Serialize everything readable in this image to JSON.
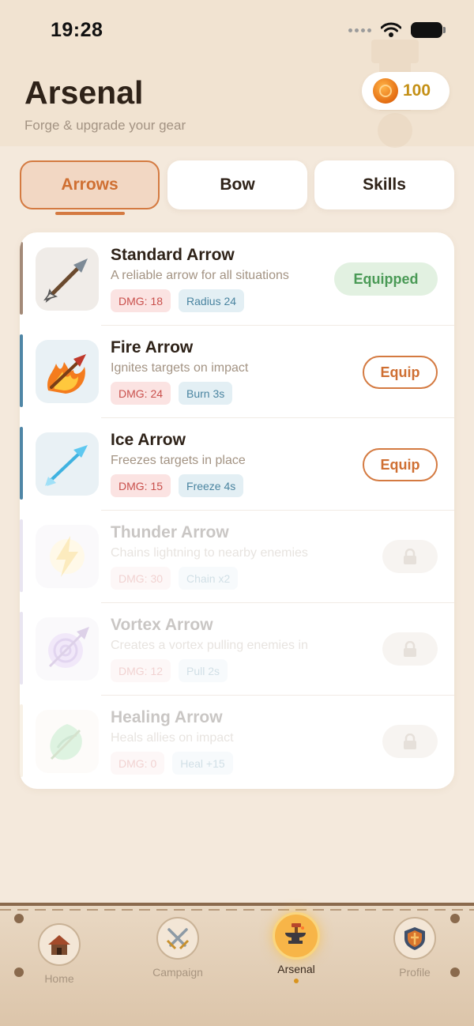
{
  "status_bar": {
    "time": "19:28"
  },
  "header": {
    "title": "Arsenal",
    "subtitle": "Forge & upgrade your gear",
    "coins": "100"
  },
  "tabs": [
    {
      "label": "Arrows",
      "active": true
    },
    {
      "label": "Bow",
      "active": false
    },
    {
      "label": "Skills",
      "active": false
    }
  ],
  "arrows": [
    {
      "name": "Standard Arrow",
      "description": "A reliable arrow for all situations",
      "damage": "DMG: 18",
      "effect": "Radius 24",
      "action": "Equipped",
      "accent": "#a38a78"
    },
    {
      "name": "Fire Arrow",
      "description": "Ignites targets on impact",
      "damage": "DMG: 24",
      "effect": "Burn 3s",
      "action": "Equip",
      "accent": "#4f86a6"
    },
    {
      "name": "Ice Arrow",
      "description": "Freezes targets in place",
      "damage": "DMG: 15",
      "effect": "Freeze 4s",
      "action": "Equip",
      "accent": "#4f86a6"
    },
    {
      "name": "Thunder Arrow",
      "description": "Chains lightning to nearby enemies",
      "damage": "DMG: 30",
      "effect": "Chain x2",
      "action": "locked",
      "accent": "#a897c8"
    },
    {
      "name": "Vortex Arrow",
      "description": "Creates a vortex pulling enemies in",
      "damage": "DMG: 12",
      "effect": "Pull 2s",
      "action": "locked",
      "accent": "#a897c8"
    },
    {
      "name": "Healing Arrow",
      "description": "Heals allies on impact",
      "damage": "DMG: 0",
      "effect": "Heal +15",
      "action": "locked",
      "accent": "#e3c99a"
    }
  ],
  "nav": [
    {
      "label": "Home",
      "icon": "house-icon"
    },
    {
      "label": "Campaign",
      "icon": "crossed-swords-icon"
    },
    {
      "label": "Arsenal",
      "icon": "anvil-icon",
      "active": true
    },
    {
      "label": "Profile",
      "icon": "shield-icon"
    }
  ]
}
